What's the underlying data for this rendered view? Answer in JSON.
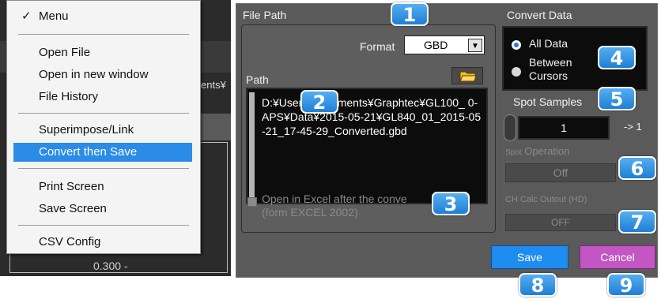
{
  "background_app": {
    "label_fragment": "ents¥",
    "axis_value": "0.300 -"
  },
  "menu": {
    "items": [
      {
        "label": "Menu",
        "checked": true
      },
      {
        "label": "Open File"
      },
      {
        "label": "Open in new window"
      },
      {
        "label": "File History"
      },
      {
        "label": "Superimpose/Link"
      },
      {
        "label": "Convert then Save",
        "highlighted": true
      },
      {
        "label": "Print Screen"
      },
      {
        "label": "Save Screen"
      },
      {
        "label": "CSV Config"
      }
    ],
    "check_glyph": "✓"
  },
  "dialog": {
    "file_path_title": "File Path",
    "format_label": "Format",
    "format_value": "GBD",
    "path_label": "Path",
    "path_text": "D:¥User        ¥Documents¥Graphtec¥GL100_         0-APS¥Data¥2015-05-21¥GL840_01_2015-05-21_17-45-29_Converted.gbd",
    "excel_checkbox_label": "Open in Excel after the conve",
    "excel_checkbox_sub": "(form EXCEL 2002)",
    "convert_data_title": "Convert Data",
    "radio_all": "All Data",
    "radio_between": "Between\nCursors",
    "spot_samples_label": "Spot Samples",
    "spot_samples_value": "1",
    "spot_samples_arrow": "-> 1",
    "spot_operation_label": "Operation",
    "spot_operation_prefix": "Spot",
    "spot_operation_value": "Off",
    "ch_calc_label": "CH Calc Outout (HD)",
    "ch_calc_value": "OFF",
    "save_label": "Save",
    "cancel_label": "Cancel"
  },
  "badges": [
    "1",
    "2",
    "3",
    "4",
    "5",
    "6",
    "7",
    "8",
    "9"
  ],
  "colors": {
    "accent_blue": "#2a8ce6",
    "badge_blue": "#1e7fd6",
    "save_button": "#1f8cf0",
    "cancel_button": "#c455c4",
    "dialog_bg": "#5a5a5a"
  }
}
